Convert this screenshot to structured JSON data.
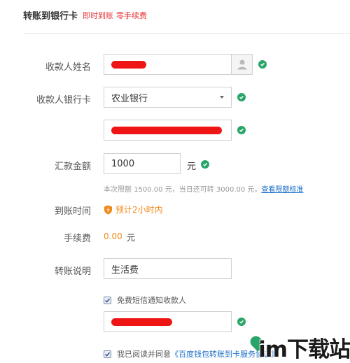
{
  "header": {
    "title": "转账到银行卡",
    "tag_instant": "即时到账",
    "tag_free": "零手续费"
  },
  "form": {
    "payee_name": {
      "label": "收款人姓名"
    },
    "bank": {
      "label": "收款人银行卡",
      "selected": "农业银行"
    },
    "amount": {
      "label": "汇款金额",
      "value": "1000",
      "unit": "元",
      "hint": "本次限额 1500.00 元，当日还可转 3000.00 元。",
      "hint_link": "查看限额标准"
    },
    "arrival": {
      "label": "到账时间",
      "value": "预计2小时内"
    },
    "fee": {
      "label": "手续费",
      "value": "0.00",
      "unit": "元"
    },
    "note": {
      "label": "转账说明",
      "value": "生活费"
    },
    "sms": {
      "label": "免费短信通知收款人",
      "checked": true
    },
    "agree": {
      "text": "我已阅读并同意",
      "link": "《百度钱包转账到卡服务协议》",
      "checked": true
    }
  },
  "watermark": {
    "text": "im下载站"
  },
  "colors": {
    "check_green": "#2aa56a",
    "accent_red": "#e4393c",
    "orange": "#f08a1c",
    "link_blue": "#1a6fc9",
    "redaction": "#f01515"
  }
}
